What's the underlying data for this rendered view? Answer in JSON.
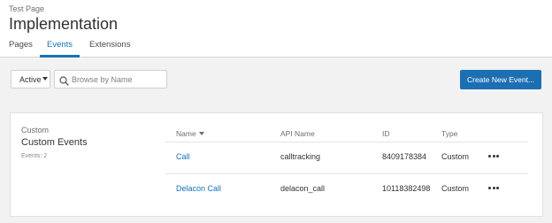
{
  "header": {
    "breadcrumb": "Test Page",
    "title": "Implementation",
    "tabs": [
      {
        "label": "Pages"
      },
      {
        "label": "Events",
        "active": true
      },
      {
        "label": "Extensions"
      }
    ]
  },
  "toolbar": {
    "filter_value": "Active",
    "search_placeholder": "Browse by Name",
    "create_label": "Create New Event..."
  },
  "section": {
    "small_label": "Custom",
    "title": "Custom Events",
    "count": "Events: 2"
  },
  "table": {
    "columns": {
      "name": "Name",
      "api": "API Name",
      "id": "ID",
      "type": "Type"
    },
    "rows": [
      {
        "name": "Call",
        "api": "calltracking",
        "id": "8409178384",
        "type": "Custom"
      },
      {
        "name": "Delacon Call",
        "api": "delacon_call",
        "id": "10118382498",
        "type": "Custom"
      }
    ]
  },
  "colors": {
    "accent": "#1473b6",
    "button": "#1d6fb3",
    "background": "#f2f2f2"
  },
  "icons": [
    "search-icon",
    "chevron-down-icon",
    "more-options-icon"
  ]
}
